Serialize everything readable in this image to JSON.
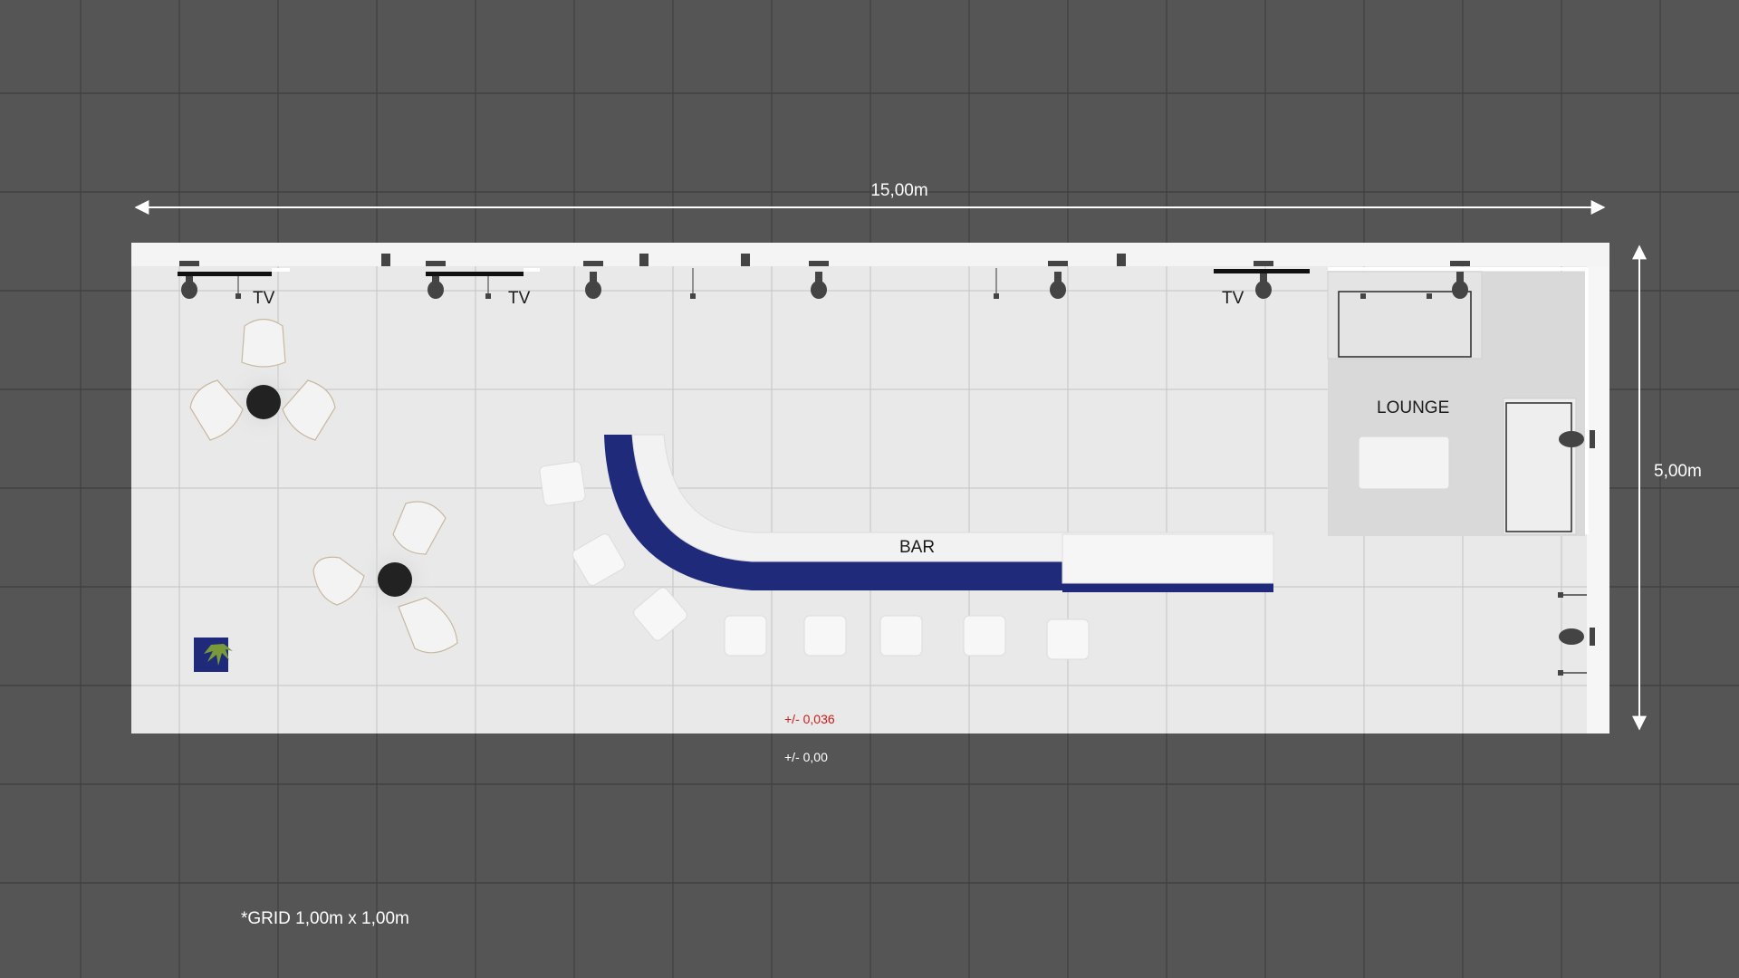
{
  "dimensions": {
    "width_label": "15,00m",
    "depth_label": "5,00m"
  },
  "labels": {
    "tv_1": "TV",
    "tv_2": "TV",
    "tv_3": "TV",
    "lounge": "LOUNGE",
    "bar": "BAR"
  },
  "levels": {
    "floor_level": "+/- 0,036",
    "ground_level": "+/- 0,00"
  },
  "legend": {
    "grid_note": "*GRID 1,00m x 1,00m"
  },
  "colors": {
    "background": "#555555",
    "floor": "#e9e9e9",
    "bar_blue": "#1f2a7a",
    "level_red": "#d11a1a",
    "grid_line": "#3f3f3f"
  }
}
